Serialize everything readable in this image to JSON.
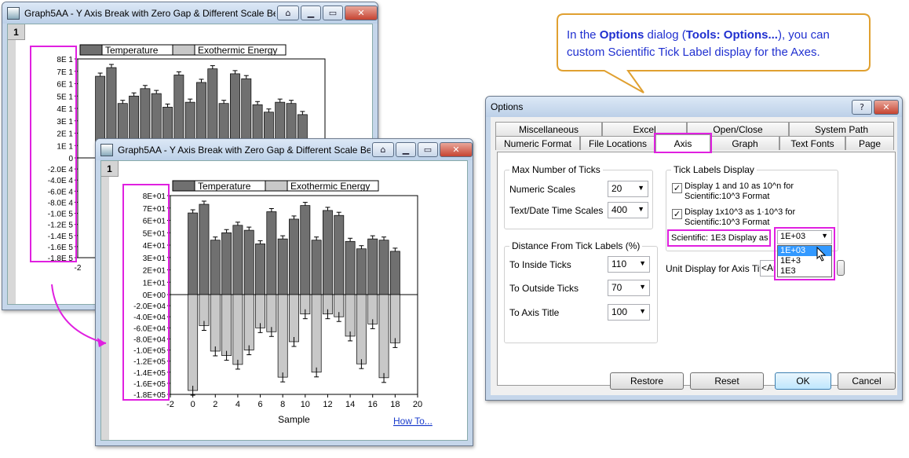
{
  "back_window": {
    "title": "Graph5AA - Y Axis Break with Zero Gap & Different Scale Be...",
    "layer": "1",
    "legend": [
      "Temperature",
      "Exothermic Energy"
    ],
    "y_ticks": [
      "8E 1",
      "7E 1",
      "6E 1",
      "5E 1",
      "4E 1",
      "3E 1",
      "2E 1",
      "1E 1",
      "0",
      "-2.0E 4",
      "-4.0E 4",
      "-6.0E 4",
      "-8.0E 4",
      "-1.0E 5",
      "-1.2E 5",
      "-1.4E 5",
      "-1.6E 5",
      "-1.8E 5"
    ],
    "x_tick_first": "-2"
  },
  "front_window": {
    "title": "Graph5AA - Y Axis Break with Zero Gap & Different Scale Be...",
    "layer": "1",
    "legend": [
      "Temperature",
      "Exothermic Energy"
    ],
    "x_label": "Sample",
    "how_to": "How To...",
    "y_ticks": [
      "8E+01",
      "7E+01",
      "6E+01",
      "5E+01",
      "4E+01",
      "3E+01",
      "2E+01",
      "1E+01",
      "0E+00",
      "-2.0E+04",
      "-4.0E+04",
      "-6.0E+04",
      "-8.0E+04",
      "-1.0E+05",
      "-1.2E+05",
      "-1.4E+05",
      "-1.6E+05",
      "-1.8E+05"
    ],
    "x_ticks": [
      "-2",
      "0",
      "2",
      "4",
      "6",
      "8",
      "10",
      "12",
      "14",
      "16",
      "18",
      "20"
    ]
  },
  "chart_data": {
    "type": "bar",
    "x": [
      0,
      1,
      2,
      3,
      4,
      5,
      6,
      7,
      8,
      9,
      10,
      11,
      12,
      13,
      14,
      15,
      16,
      17,
      18
    ],
    "series": [
      {
        "name": "Temperature",
        "values": [
          66,
          73,
          44,
          50,
          56,
          52,
          41,
          67,
          45,
          61,
          72,
          44,
          68,
          64,
          43,
          37,
          45,
          44,
          35
        ]
      },
      {
        "name": "Exothermic Energy",
        "values": [
          -173000,
          -56000,
          -102000,
          -110000,
          -126000,
          -100000,
          -60000,
          -67000,
          -149000,
          -85000,
          -35000,
          -140000,
          -35000,
          -40000,
          -75000,
          -125000,
          -53000,
          -150000,
          -87000
        ]
      }
    ],
    "xlabel": "Sample",
    "xlim": [
      -2,
      20
    ],
    "ylim_top": [
      0,
      80
    ],
    "ylim_bottom": [
      -180000,
      0
    ]
  },
  "callout": {
    "pre": "In the ",
    "b1": "Options",
    "mid": " dialog (",
    "b2": "Tools: Options...",
    "post": "), you can custom Scientific Tick Label display for the Axes."
  },
  "dialog": {
    "title": "Options",
    "help_glyph": "?",
    "close_glyph": "✕",
    "tabs_row1": [
      "Miscellaneous",
      "Excel",
      "Open/Close",
      "System Path"
    ],
    "tabs_row2": [
      "Numeric Format",
      "File Locations",
      "Axis",
      "Graph",
      "Text Fonts",
      "Page"
    ],
    "max_ticks": {
      "label": "Max Number of Ticks",
      "numeric_label": "Numeric Scales",
      "numeric_value": "20",
      "text_label": "Text/Date Time Scales",
      "text_value": "400"
    },
    "distance": {
      "label": "Distance From Tick Labels (%)",
      "inside_label": "To Inside Ticks",
      "inside_value": "110",
      "outside_label": "To Outside Ticks",
      "outside_value": "70",
      "title_label": "To Axis Title",
      "title_value": "100"
    },
    "tick_display": {
      "label": "Tick Labels Display",
      "opt1": "Display 1 and 10 as 10^n for Scientific:10^3 Format",
      "opt2": "Display 1x10^3 as 1·10^3 for Scientific:10^3 Format",
      "sci_label": "Scientific: 1E3 Display as",
      "sci_value": "1E+03",
      "sci_options": [
        "1E+03",
        "1E+3",
        "1E3"
      ],
      "unit_label": "Unit Display for Axis Title",
      "unit_value": "<Au"
    },
    "buttons": {
      "restore": "Restore",
      "reset": "Reset",
      "ok": "OK",
      "cancel": "Cancel"
    }
  }
}
